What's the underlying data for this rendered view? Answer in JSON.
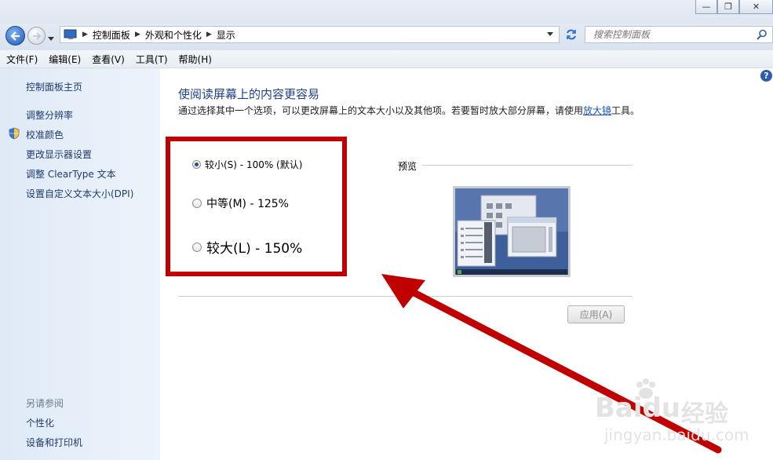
{
  "window": {
    "minimize_glyph": "—",
    "restore_glyph": "❐",
    "close_glyph": "✕"
  },
  "address": {
    "crumbs": [
      "控制面板",
      "外观和个性化",
      "显示"
    ],
    "search_placeholder": "搜索控制面板"
  },
  "menu": [
    "文件(F)",
    "编辑(E)",
    "查看(V)",
    "工具(T)",
    "帮助(H)"
  ],
  "sidebar": {
    "home": "控制面板主页",
    "links": [
      "调整分辨率",
      "校准颜色",
      "更改显示器设置",
      "调整 ClearType 文本",
      "设置自定义文本大小(DPI)"
    ],
    "see_also_heading": "另请参阅",
    "see_also": [
      "个性化",
      "设备和打印机"
    ]
  },
  "main": {
    "title": "使阅读屏幕上的内容更容易",
    "description_before_link": "通过选择其中一个选项，可以更改屏幕上的文本大小以及其他项。若要暂时放大部分屏幕，请使用",
    "description_link": "放大镜",
    "description_after_link": "工具。",
    "options": [
      {
        "label": "较小(S) - 100% (默认)",
        "selected": true
      },
      {
        "label": "中等(M) - 125%",
        "selected": false
      },
      {
        "label": "较大(L) - 150%",
        "selected": false
      }
    ],
    "preview_label": "预览",
    "apply_label": "应用(A)",
    "help_glyph": "?"
  },
  "watermark": {
    "brand": "Baidu",
    "cn": "经验",
    "url": "jingyan.baidu.com"
  },
  "colors": {
    "annotation": "#c00000",
    "link": "#1a56b8",
    "title": "#1e3f8a"
  }
}
